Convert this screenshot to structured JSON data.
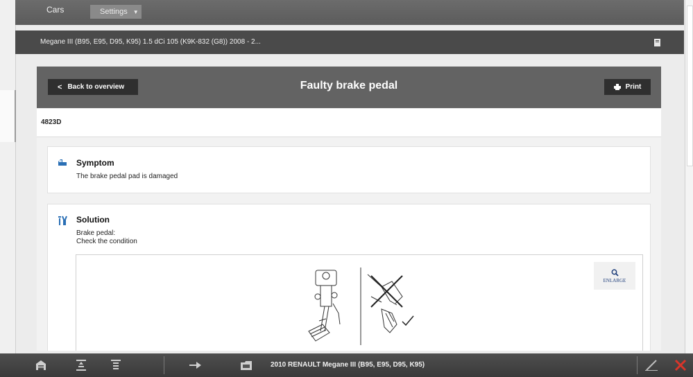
{
  "topnav": {
    "cars_label": "Cars",
    "settings_label": "Settings"
  },
  "vehicle": {
    "title": "Megane III (B95, E95, D95, K95) 1.5 dCi 105 (K9K-832 (G8)) 2008 - 2..."
  },
  "page": {
    "back_label": "Back to overview",
    "title": "Faulty brake pedal",
    "print_label": "Print",
    "code": "4823D"
  },
  "symptom": {
    "title": "Symptom",
    "text": "The brake pedal pad is damaged"
  },
  "solution": {
    "title": "Solution",
    "line1": "Brake pedal:",
    "line2": "Check the condition",
    "enlarge_label": "ENLARGE"
  },
  "bottombar": {
    "vehicle_label": "2010 RENAULT Megane III (B95, E95, D95, K95)"
  },
  "colors": {
    "header_bg": "#636363",
    "button_bg": "#2f2f2f",
    "bottombar_bg": "#444444",
    "close_red": "#d9352a"
  }
}
